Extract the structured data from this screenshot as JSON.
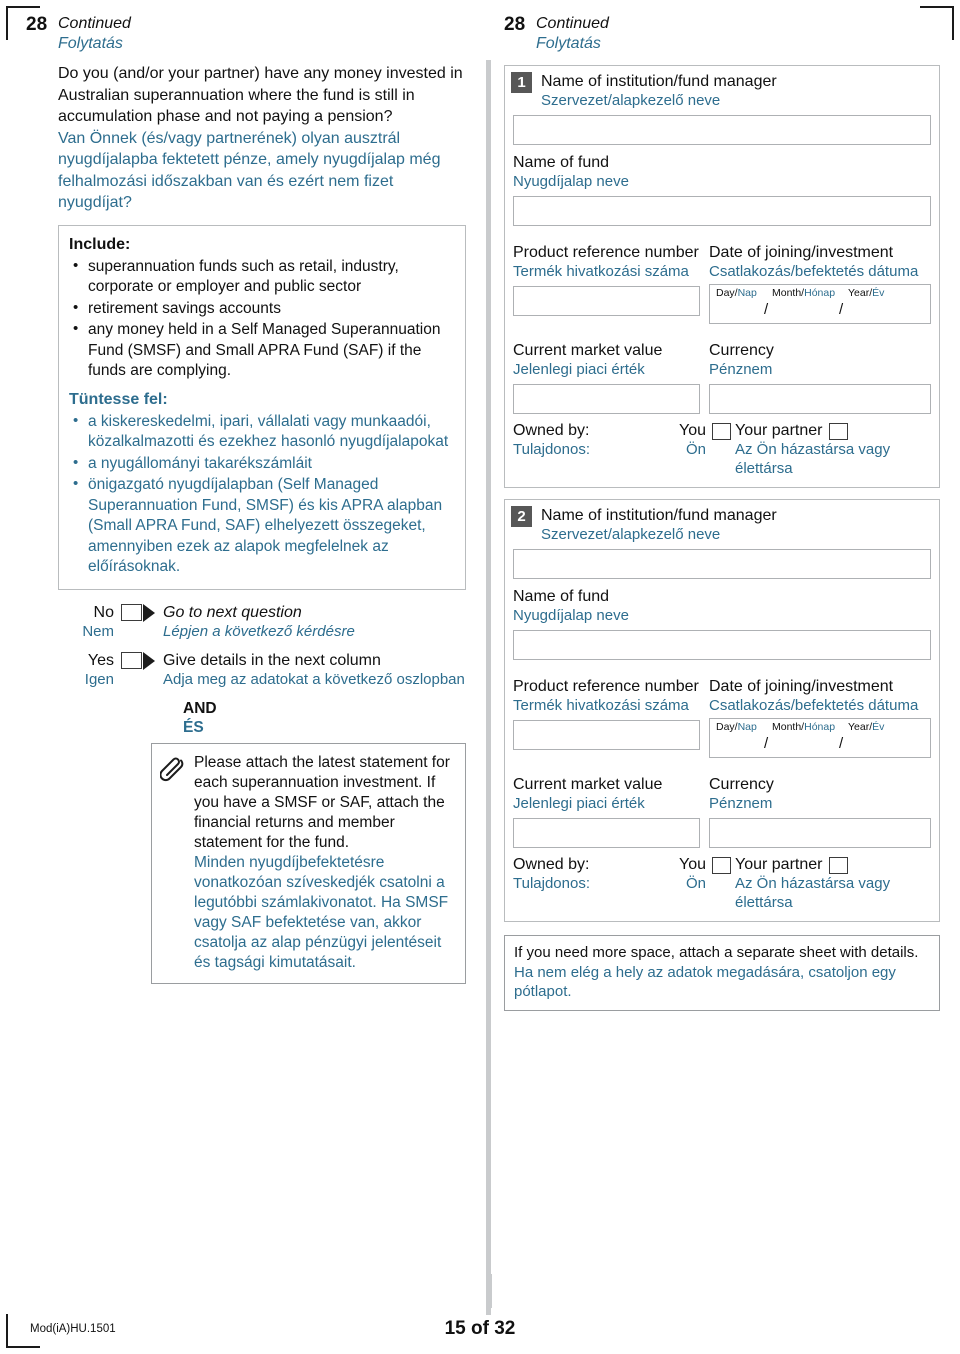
{
  "page": {
    "form_code": "Mod(iA)HU.1501",
    "page_label": "15 of 32",
    "accent_color": "#2d6d8e",
    "badge_color": "#575757"
  },
  "question": {
    "number": "28",
    "continued_en": "Continued",
    "continued_hu": "Folytatás",
    "text_en": "Do you (and/or your partner) have any money invested in Australian superannuation where the fund is still in accumulation phase and not paying a pension?",
    "text_hu": "Van Önnek (és/vagy partnerének) olyan ausztrál nyugdíjalapba fektetett pénze, amely nyugdíjalap még felhalmozási időszakban van és ezért nem fizet nyugdíjat?"
  },
  "include_panel": {
    "heading_en": "Include:",
    "bullets_en": [
      "superannuation funds such as retail, industry, corporate or employer and public sector",
      "retirement savings accounts",
      "any money held in a Self Managed Superannuation Fund (SMSF) and Small APRA Fund (SAF) if the funds are complying."
    ],
    "heading_hu": "Tüntesse fel:",
    "bullets_hu": [
      "a kiskereskedelmi, ipari, vállalati vagy munkaadói, közalkalmazotti és ezekhez hasonló nyugdíjalapokat",
      "a nyugállományi takarékszámláit",
      "önigazgató nyugdíjalapban (Self Managed Superannuation Fund, SMSF) és kis APRA alapban (Small APRA Fund, SAF) elhelyezett összegeket, amennyiben ezek az alapok megfelelnek az előírásoknak."
    ]
  },
  "answers": {
    "no": {
      "label_en": "No",
      "label_hu": "Nem",
      "action_en": "Go to next question",
      "action_hu": "Lépjen a következő kérdésre"
    },
    "yes": {
      "label_en": "Yes",
      "label_hu": "Igen",
      "action_en": "Give details in the next column",
      "action_hu": "Adja meg az adatokat a következő oszlopban"
    },
    "and_en": "AND",
    "and_hu": "ÉS"
  },
  "attach_note": {
    "icon": "paperclip-icon",
    "text_en": "Please attach the latest statement for each superannuation investment. If you have a SMSF or SAF, attach the financial returns and member statement for the fund.",
    "text_hu": "Minden nyugdíjbefektetésre vonatkozóan szíveskedjék csatolni a legutóbbi számlakivonatot. Ha SMSF vagy SAF befektetése van, akkor csatolja az alap pénzügyi jelentéseit és tagsági kimutatásait."
  },
  "right_header": {
    "number": "28",
    "continued_en": "Continued",
    "continued_hu": "Folytatás"
  },
  "field_labels": {
    "institution_en": "Name of institution/fund manager",
    "institution_hu": "Szervezet/alapkezelő neve",
    "fund_en": "Name of fund",
    "fund_hu": "Nyugdíjalap neve",
    "product_ref_en": "Product reference number",
    "product_ref_hu": "Termék hivatkozási száma",
    "date_en": "Date of joining/investment",
    "date_hu": "Csatlakozás/befektetés dátuma",
    "day": "Day/Nap",
    "month": "Month/Hónap",
    "year": "Year/Év",
    "day_en": "Day/",
    "day_hu": "Nap",
    "month_en": "Month/",
    "month_hu": "Hónap",
    "year_en": "Year/",
    "year_hu": "Év",
    "slash": "/",
    "market_value_en": "Current market value",
    "market_value_hu": "Jelenlegi piaci érték",
    "currency_en": "Currency",
    "currency_hu": "Pénznem",
    "owned_by_en": "Owned by:",
    "owned_by_hu": "Tulajdonos:",
    "you_en": "You",
    "you_hu": "Ön",
    "partner_en": "Your partner",
    "partner_hu": "Az Ön házastársa vagy élettársa"
  },
  "blocks": [
    {
      "badge": "1"
    },
    {
      "badge": "2"
    }
  ],
  "more_space": {
    "text_en": "If you need more space, attach a separate sheet with details.",
    "text_hu": "Ha nem elég a hely az adatok megadására, csatoljon egy pótlapot."
  }
}
